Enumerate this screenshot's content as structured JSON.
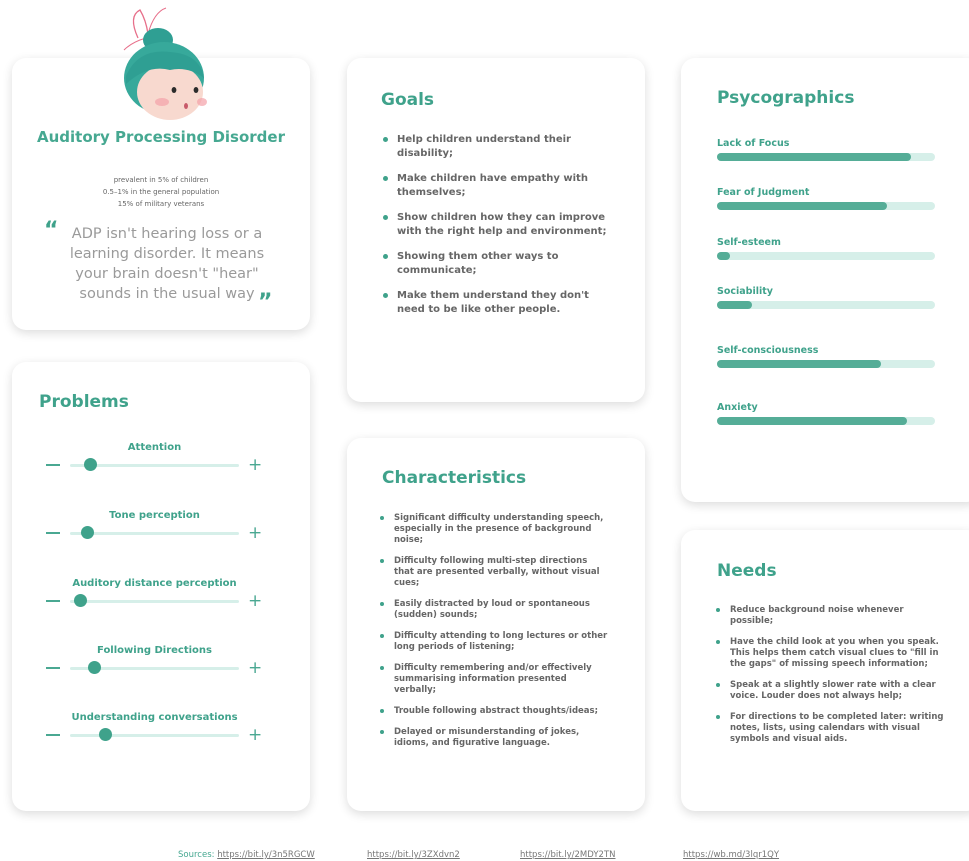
{
  "profile": {
    "title": "Auditory Processing Disorder",
    "stats": [
      "prevalent in 5% of children",
      "0.5–1% in the general population",
      "15% of military veterans"
    ],
    "quote": "ADP isn't hearing loss or a learning disorder. It means your brain doesn't \"hear\" sounds in the usual way",
    "quote_open": "“",
    "quote_close": "”"
  },
  "problems": {
    "title": "Problems",
    "minus": "—",
    "plus": "+",
    "sliders": [
      {
        "label": "Attention",
        "level": 0.12
      },
      {
        "label": "Tone perception",
        "level": 0.1
      },
      {
        "label": "Auditory distance perception",
        "level": 0.06
      },
      {
        "label": "Following Directions",
        "level": 0.14
      },
      {
        "label": "Understanding conversations",
        "level": 0.21
      }
    ]
  },
  "goals": {
    "title": "Goals",
    "items": [
      "Help children understand their disability;",
      "Make children have empathy with themselves;",
      "Show children how they can improve with the right help and environment;",
      "Showing them other ways to communicate;",
      "Make them understand they don't need to be like other people."
    ]
  },
  "characteristics": {
    "title": "Characteristics",
    "items": [
      "Significant difficulty understanding speech, especially in the presence of background noise;",
      "Difficulty following multi-step directions that are presented verbally, without visual cues;",
      "Easily distracted by loud or spontaneous (sudden) sounds;",
      "Difficulty attending to long lectures or other long periods of listening;",
      "Difficulty remembering and/or effectively summarising information presented verbally;",
      "Trouble following abstract thoughts/ideas;",
      "Delayed or misunderstanding of jokes, idioms, and figurative language."
    ]
  },
  "psycographics": {
    "title": "Psycographics",
    "bars": [
      {
        "label": "Lack of Focus",
        "value": 0.89
      },
      {
        "label": "Fear of Judgment",
        "value": 0.78
      },
      {
        "label": "Self-esteem",
        "value": 0.06
      },
      {
        "label": "Sociability",
        "value": 0.16
      },
      {
        "label": "Self-consciousness",
        "value": 0.75
      },
      {
        "label": "Anxiety",
        "value": 0.87
      }
    ]
  },
  "needs": {
    "title": "Needs",
    "items": [
      "Reduce background noise whenever possible;",
      "Have the child look at you when you speak. This helps them catch visual clues to \"fill in the gaps\" of missing speech information;",
      "Speak at a slightly slower rate with a clear voice. Louder does not always help;",
      "For directions to be completed later: writing notes, lists, using calendars with visual symbols and visual aids."
    ]
  },
  "sources": {
    "label": "Sources:",
    "links": [
      "https://bit.ly/3n5RGCW",
      "https://bit.ly/3ZXdvn2",
      "https://bit.ly/2MDY2TN",
      "https://wb.md/3lqr1QY"
    ]
  },
  "colors": {
    "accent": "#3fa28b",
    "track": "#d6efe9",
    "hair": "#3fa99a",
    "skin": "#f8d9cf"
  }
}
